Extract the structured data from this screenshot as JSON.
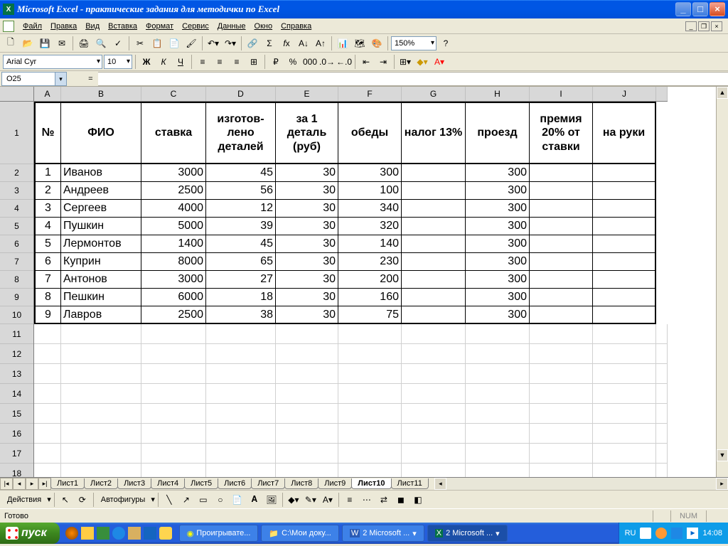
{
  "app": {
    "title": "Microsoft Excel - практические задания для методички по Excel",
    "icon_letter": "X"
  },
  "menu": {
    "items": [
      "Файл",
      "Правка",
      "Вид",
      "Вставка",
      "Формат",
      "Сервис",
      "Данные",
      "Окно",
      "Справка"
    ]
  },
  "formatting": {
    "font_name": "Arial Cyr",
    "font_size": "10",
    "zoom": "150%"
  },
  "formula_bar": {
    "cell_ref": "O25",
    "fx_label": "=",
    "value": ""
  },
  "grid": {
    "cols": [
      {
        "letter": "A",
        "width": 38
      },
      {
        "letter": "B",
        "width": 113
      },
      {
        "letter": "C",
        "width": 91
      },
      {
        "letter": "D",
        "width": 98
      },
      {
        "letter": "E",
        "width": 88
      },
      {
        "letter": "F",
        "width": 89
      },
      {
        "letter": "G",
        "width": 90
      },
      {
        "letter": "H",
        "width": 90
      },
      {
        "letter": "I",
        "width": 89
      },
      {
        "letter": "J",
        "width": 89
      },
      {
        "letter": "",
        "width": 16
      }
    ],
    "header_row_height": 88,
    "data_row_height": 25,
    "empty_row_height": 28,
    "headers": [
      "№",
      "ФИО",
      "ставка",
      "изготов-лено деталей",
      "за 1 деталь (руб)",
      "обеды",
      "налог 13%",
      "проезд",
      "премия 20% от ставки",
      "на руки"
    ],
    "rows": [
      {
        "n": 1,
        "fio": "Иванов",
        "stavka": 3000,
        "det": 45,
        "za1": 30,
        "obedy": 300,
        "nalog": "",
        "proezd": 300,
        "prem": "",
        "naruki": ""
      },
      {
        "n": 2,
        "fio": "Андреев",
        "stavka": 2500,
        "det": 56,
        "za1": 30,
        "obedy": 100,
        "nalog": "",
        "proezd": 300,
        "prem": "",
        "naruki": ""
      },
      {
        "n": 3,
        "fio": "Сергеев",
        "stavka": 4000,
        "det": 12,
        "za1": 30,
        "obedy": 340,
        "nalog": "",
        "proezd": 300,
        "prem": "",
        "naruki": ""
      },
      {
        "n": 4,
        "fio": "Пушкин",
        "stavka": 5000,
        "det": 39,
        "za1": 30,
        "obedy": 320,
        "nalog": "",
        "proezd": 300,
        "prem": "",
        "naruki": ""
      },
      {
        "n": 5,
        "fio": "Лермонтов",
        "stavka": 1400,
        "det": 45,
        "za1": 30,
        "obedy": 140,
        "nalog": "",
        "proezd": 300,
        "prem": "",
        "naruki": ""
      },
      {
        "n": 6,
        "fio": "Куприн",
        "stavka": 8000,
        "det": 65,
        "za1": 30,
        "obedy": 230,
        "nalog": "",
        "proezd": 300,
        "prem": "",
        "naruki": ""
      },
      {
        "n": 7,
        "fio": "Антонов",
        "stavka": 3000,
        "det": 27,
        "za1": 30,
        "obedy": 200,
        "nalog": "",
        "proezd": 300,
        "prem": "",
        "naruki": ""
      },
      {
        "n": 8,
        "fio": "Пешкин",
        "stavka": 6000,
        "det": 18,
        "za1": 30,
        "obedy": 160,
        "nalog": "",
        "proezd": 300,
        "prem": "",
        "naruki": ""
      },
      {
        "n": 9,
        "fio": "Лавров",
        "stavka": 2500,
        "det": 38,
        "za1": 30,
        "obedy": 75,
        "nalog": "",
        "proezd": 300,
        "prem": "",
        "naruki": ""
      }
    ],
    "row_numbers": [
      1,
      2,
      3,
      4,
      5,
      6,
      7,
      8,
      9,
      10,
      11,
      12,
      13,
      14,
      15,
      16,
      17,
      18
    ],
    "sheets": [
      "Лист1",
      "Лист2",
      "Лист3",
      "Лист4",
      "Лист5",
      "Лист6",
      "Лист7",
      "Лист8",
      "Лист9",
      "Лист10",
      "Лист11"
    ],
    "active_sheet": "Лист10"
  },
  "draw": {
    "actions": "Действия",
    "autoshapes": "Автофигуры"
  },
  "status": {
    "ready": "Готово",
    "num": "NUM"
  },
  "taskbar": {
    "start": "пуск",
    "tasks": [
      "Проигрывате...",
      "C:\\Мои доку...",
      "2 Microsoft ...",
      "2 Microsoft ..."
    ],
    "lang": "RU",
    "time": "14:08"
  }
}
